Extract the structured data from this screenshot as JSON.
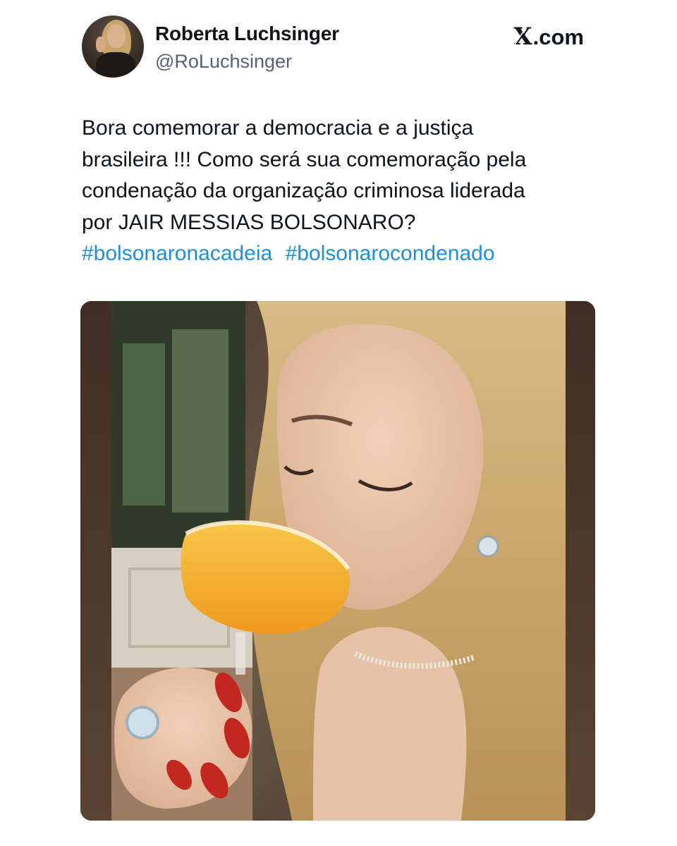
{
  "post": {
    "author": {
      "name": "Roberta Luchsinger",
      "handle": "@RoLuchsinger",
      "avatar": "profile-photo"
    },
    "site_label": "X.com",
    "text_lines": [
      "Bora comemorar a democracia e a justiça",
      "brasileira !!! Como será sua comemoração pela",
      "condenação da organização criminosa liderada",
      "por JAIR MESSIAS BOLSONARO?"
    ],
    "hashtags": [
      "#bolsonaronacadeia",
      "#bolsonarocondenado"
    ],
    "media": {
      "kind": "photo",
      "subject": "woman-drinking-cocktail"
    }
  },
  "colors": {
    "text": "#0f1419",
    "secondary_text": "#536471",
    "link": "#1e8fd8",
    "background": "#ffffff"
  }
}
